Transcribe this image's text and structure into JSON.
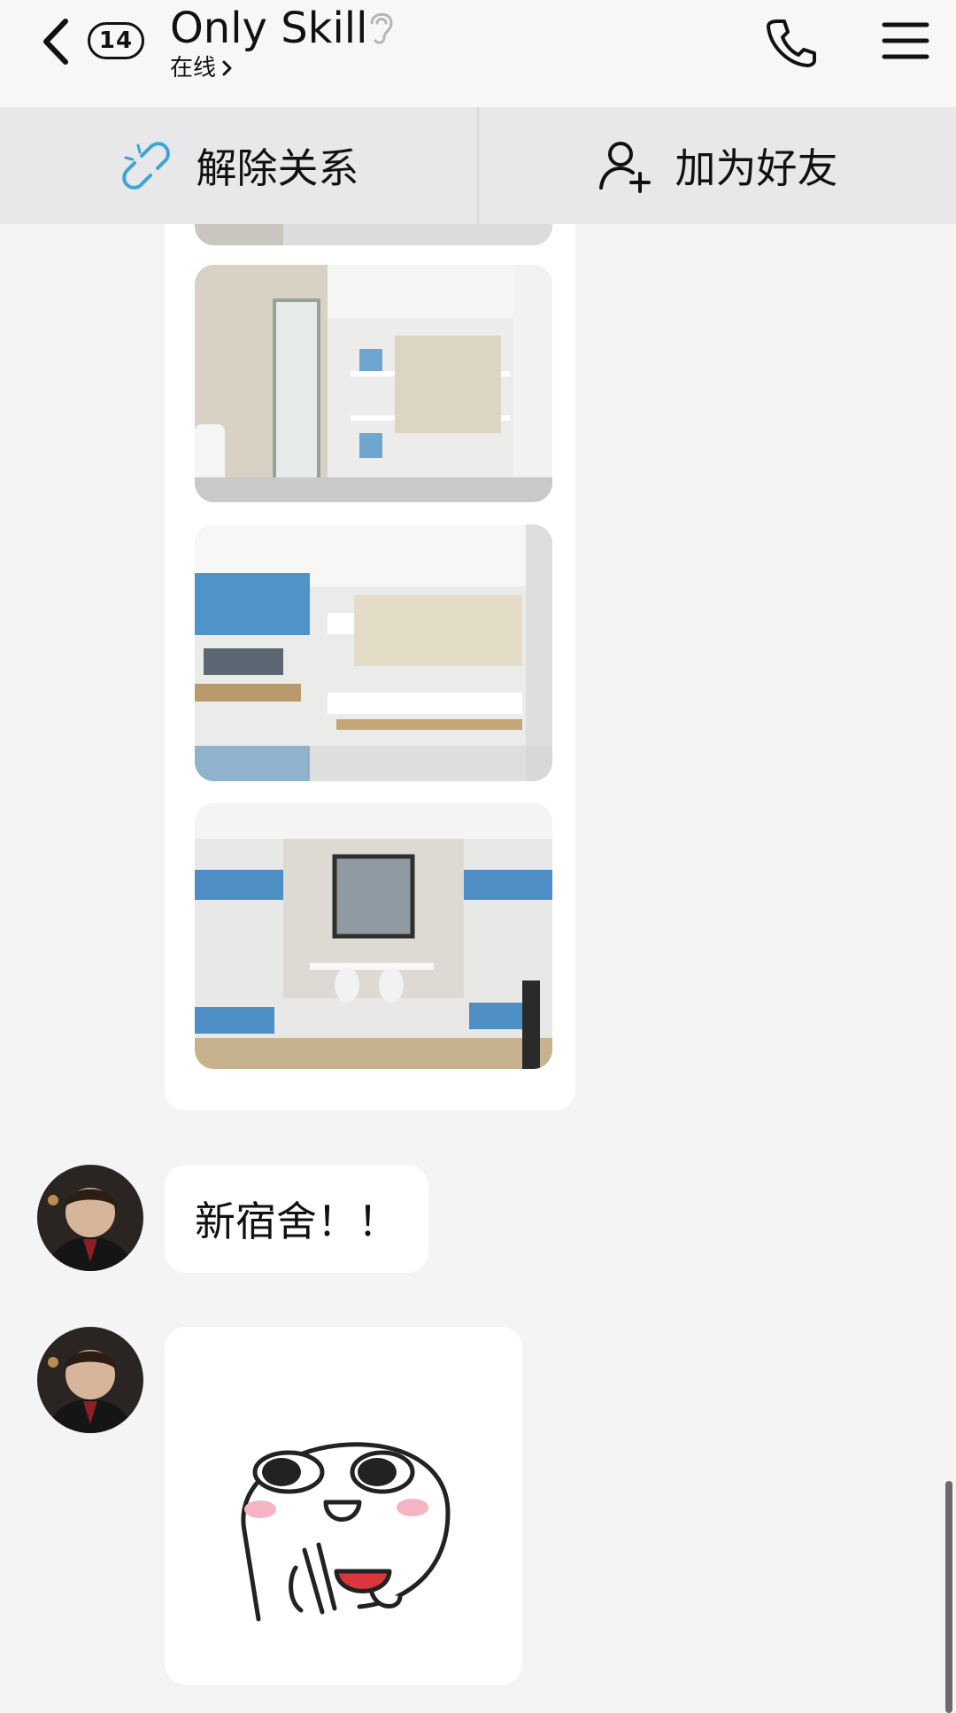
{
  "header": {
    "title": "Only Skill",
    "status": "在线",
    "unread_count": "14"
  },
  "actions": {
    "unlink_label": "解除关系",
    "add_friend_label": "加为好友"
  },
  "messages": [
    {
      "type": "image-group",
      "images": [
        "dorm-bathroom-photo",
        "dorm-bunkbeds-photo",
        "dorm-room-window-photo"
      ]
    },
    {
      "type": "text",
      "text": "新宿舍！！"
    },
    {
      "type": "sticker",
      "sticker": "eating-face-sticker"
    }
  ],
  "colors": {
    "background": "#f4f4f5",
    "header_bg": "#f7f7f8",
    "action_bar_bg": "#e8e8ea",
    "bubble": "#ffffff",
    "link_icon": "#3aa6d8"
  }
}
